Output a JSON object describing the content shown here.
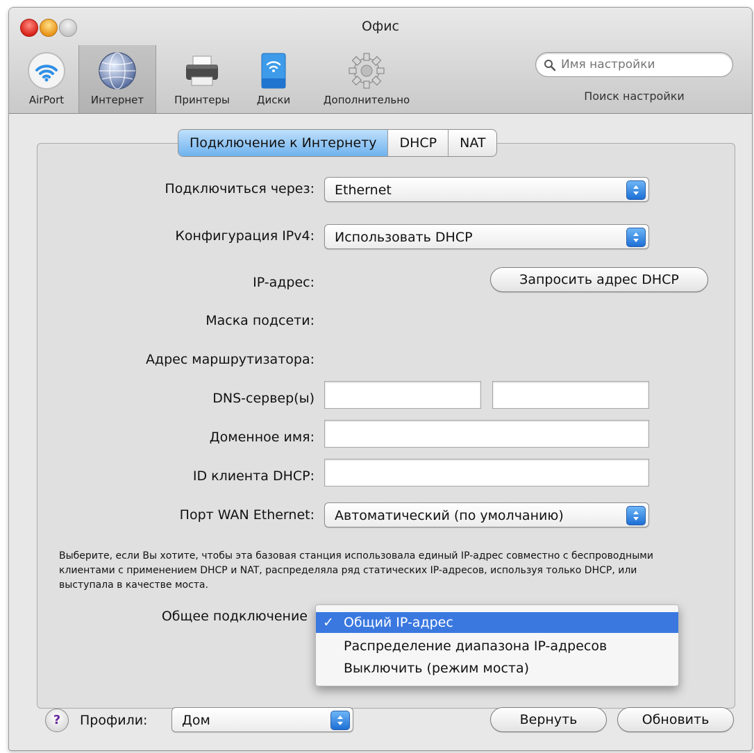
{
  "window": {
    "title": "Офис"
  },
  "toolbar": {
    "items": [
      {
        "label": "AirPort"
      },
      {
        "label": "Интернет"
      },
      {
        "label": "Принтеры"
      },
      {
        "label": "Диски"
      },
      {
        "label": "Дополнительно"
      }
    ],
    "search_placeholder": "Имя настройки",
    "search_caption": "Поиск настройки"
  },
  "tabs": [
    {
      "label": "Подключение к Интернету",
      "active": true
    },
    {
      "label": "DHCP",
      "active": false
    },
    {
      "label": "NAT",
      "active": false
    }
  ],
  "form": {
    "connect_via_label": "Подключиться через:",
    "connect_via_value": "Ethernet",
    "ipv4_label": "Конфигурация IPv4:",
    "ipv4_value": "Использовать DHCP",
    "ip_label": "IP-адрес:",
    "renew_button": "Запросить адрес DHCP",
    "subnet_label": "Маска подсети:",
    "router_label": "Адрес маршрутизатора:",
    "dns_label": "DNS-сервер(ы)",
    "domain_label": "Доменное имя:",
    "client_id_label": "ID клиента DHCP:",
    "wan_port_label": "Порт WAN Ethernet:",
    "wan_port_value": "Автоматический (по умолчанию)",
    "description": "Выберите, если Вы хотите, чтобы эта базовая станция использовала единый IP-адрес совместно с беспроводными клиентами с применением DHCP и NAT, распределяла ряд статических IP-адресов, используя только DHCP, или выступала в качестве моста.",
    "sharing_label": "Общее подключение",
    "sharing_options": [
      {
        "label": "Общий IP-адрес",
        "selected": true
      },
      {
        "label": "Распределение диапазона IP-адресов",
        "selected": false
      },
      {
        "label": "Выключить (режим моста)",
        "selected": false
      }
    ]
  },
  "footer": {
    "help": "?",
    "profiles_label": "Профили:",
    "profiles_value": "Дом",
    "revert_button": "Вернуть",
    "update_button": "Обновить"
  },
  "colors": {
    "accent": "#3a78e0",
    "active_tab": "#6fb2ee"
  }
}
